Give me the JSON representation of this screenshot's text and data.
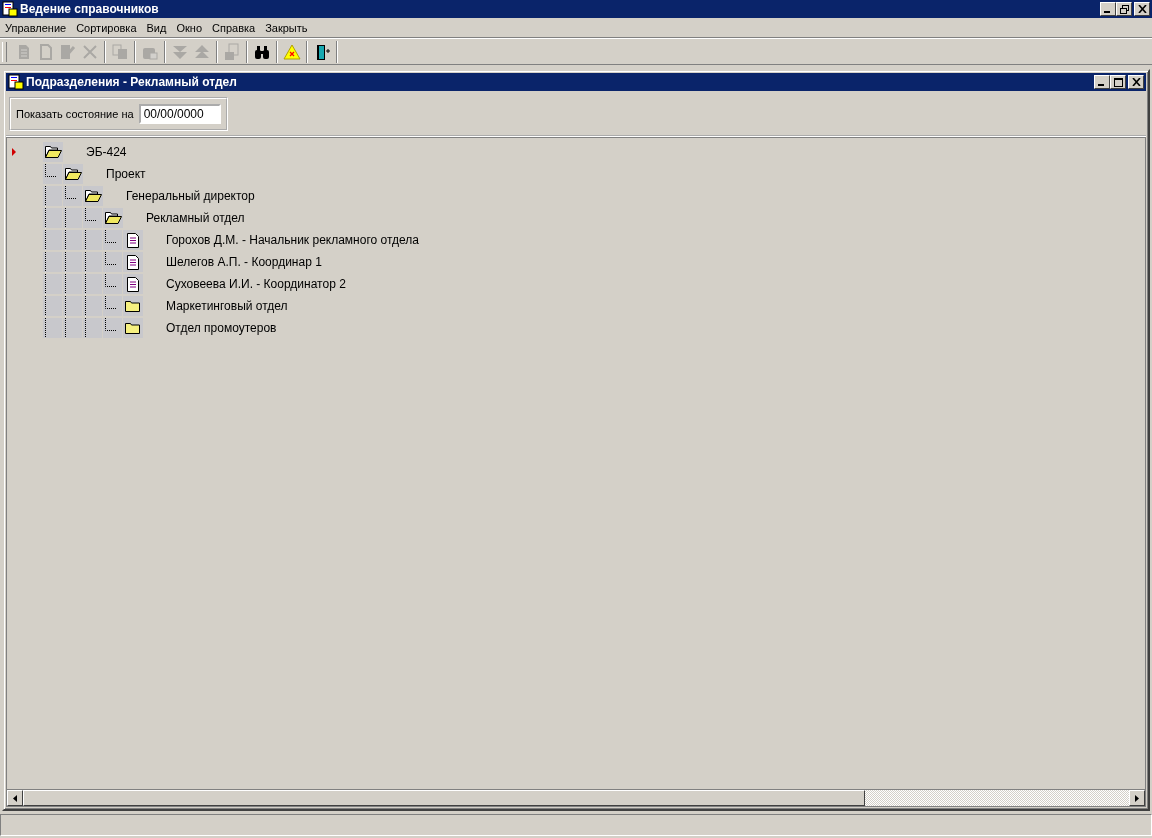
{
  "window": {
    "title": "Ведение справочников"
  },
  "menu": [
    "Управление",
    "Сортировка",
    "Вид",
    "Окно",
    "Справка",
    "Закрыть"
  ],
  "toolbar": [
    {
      "kind": "page-lines",
      "disabled": true
    },
    {
      "kind": "page",
      "disabled": true
    },
    {
      "kind": "page-pencil",
      "disabled": true
    },
    {
      "kind": "cross",
      "disabled": true
    },
    {
      "kind": "sep"
    },
    {
      "kind": "pages",
      "disabled": true
    },
    {
      "kind": "sep"
    },
    {
      "kind": "case",
      "disabled": true
    },
    {
      "kind": "sep"
    },
    {
      "kind": "down",
      "disabled": true
    },
    {
      "kind": "up",
      "disabled": true
    },
    {
      "kind": "sep"
    },
    {
      "kind": "pages-grid",
      "disabled": true
    },
    {
      "kind": "sep"
    },
    {
      "kind": "binoculars",
      "disabled": false
    },
    {
      "kind": "sep"
    },
    {
      "kind": "warning",
      "disabled": false
    },
    {
      "kind": "sep"
    },
    {
      "kind": "door",
      "disabled": false
    },
    {
      "kind": "sep"
    }
  ],
  "child_window": {
    "title": "Подразделения - Рекламный отдел"
  },
  "filter": {
    "label": "Показать состояние на",
    "value": "00/00/0000"
  },
  "tree": [
    {
      "label": "ЭБ-424",
      "kind": "folder",
      "expanded": true,
      "current": true,
      "children": [
        {
          "label": "Проект",
          "kind": "folder",
          "expanded": true,
          "current": false,
          "children": [
            {
              "label": "Генеральный директор",
              "kind": "folder",
              "expanded": true,
              "current": false,
              "children": [
                {
                  "label": "Рекламный отдел",
                  "kind": "folder",
                  "expanded": true,
                  "current": false,
                  "children": [
                    {
                      "label": "Горохов Д.М. - Начальник рекламного отдела",
                      "kind": "document",
                      "current": false
                    },
                    {
                      "label": "Шелегов А.П. - Координар 1",
                      "kind": "document",
                      "current": false
                    },
                    {
                      "label": "Суховеева И.И. - Координатор 2",
                      "kind": "document",
                      "current": false
                    },
                    {
                      "label": "Маркетинговый отдел",
                      "kind": "folder",
                      "expanded": false,
                      "current": false
                    },
                    {
                      "label": "Отдел промоутеров",
                      "kind": "folder",
                      "expanded": false,
                      "current": false
                    }
                  ]
                }
              ]
            }
          ]
        }
      ]
    }
  ]
}
